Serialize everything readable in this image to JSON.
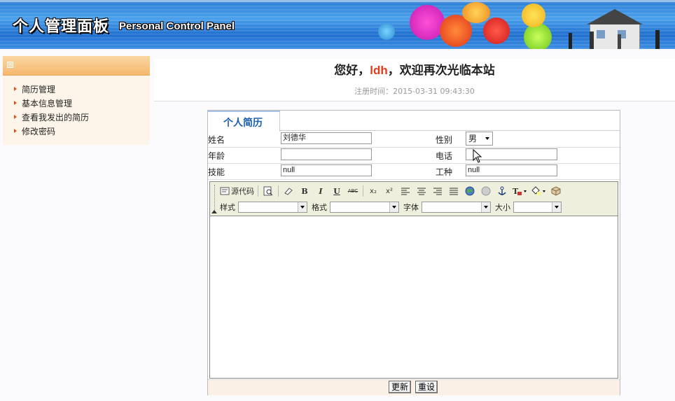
{
  "banner": {
    "title": "个人管理面板",
    "subtitle": "Personal Control Panel"
  },
  "sidebar": {
    "toggle_glyph": "⊞",
    "items": [
      {
        "label": "简历管理"
      },
      {
        "label": "基本信息管理"
      },
      {
        "label": "查看我发出的简历"
      },
      {
        "label": "修改密码"
      }
    ]
  },
  "welcome": {
    "prefix": "您好，",
    "username": "ldh",
    "suffix": "，欢迎再次光临本站",
    "reg_label": "注册时间：",
    "reg_time": "2015-03-31 09:43:30"
  },
  "form": {
    "tab_label": "个人简历",
    "name_label": "姓名",
    "name_value": "刘德华",
    "gender_label": "性别",
    "gender_value": "男",
    "age_label": "年龄",
    "age_value": "",
    "phone_label": "电话",
    "phone_value": "",
    "skill_label": "技能",
    "skill_value": "null",
    "job_label": "工种",
    "job_value": "null"
  },
  "editor": {
    "source_label": "源代码",
    "bold": "B",
    "italic": "I",
    "underline": "U",
    "strike": "ABC",
    "subscript": "x₂",
    "superscript": "x²",
    "style_label": "样式",
    "format_label": "格式",
    "font_label": "字体",
    "size_label": "大小"
  },
  "actions": {
    "update_label": "更新",
    "reset_label": "重设"
  },
  "colors": {
    "accent": "#1d5fae",
    "username": "#e03a1b",
    "sidebar_header": "#f5b86c",
    "banner": "#2d7fd6"
  }
}
